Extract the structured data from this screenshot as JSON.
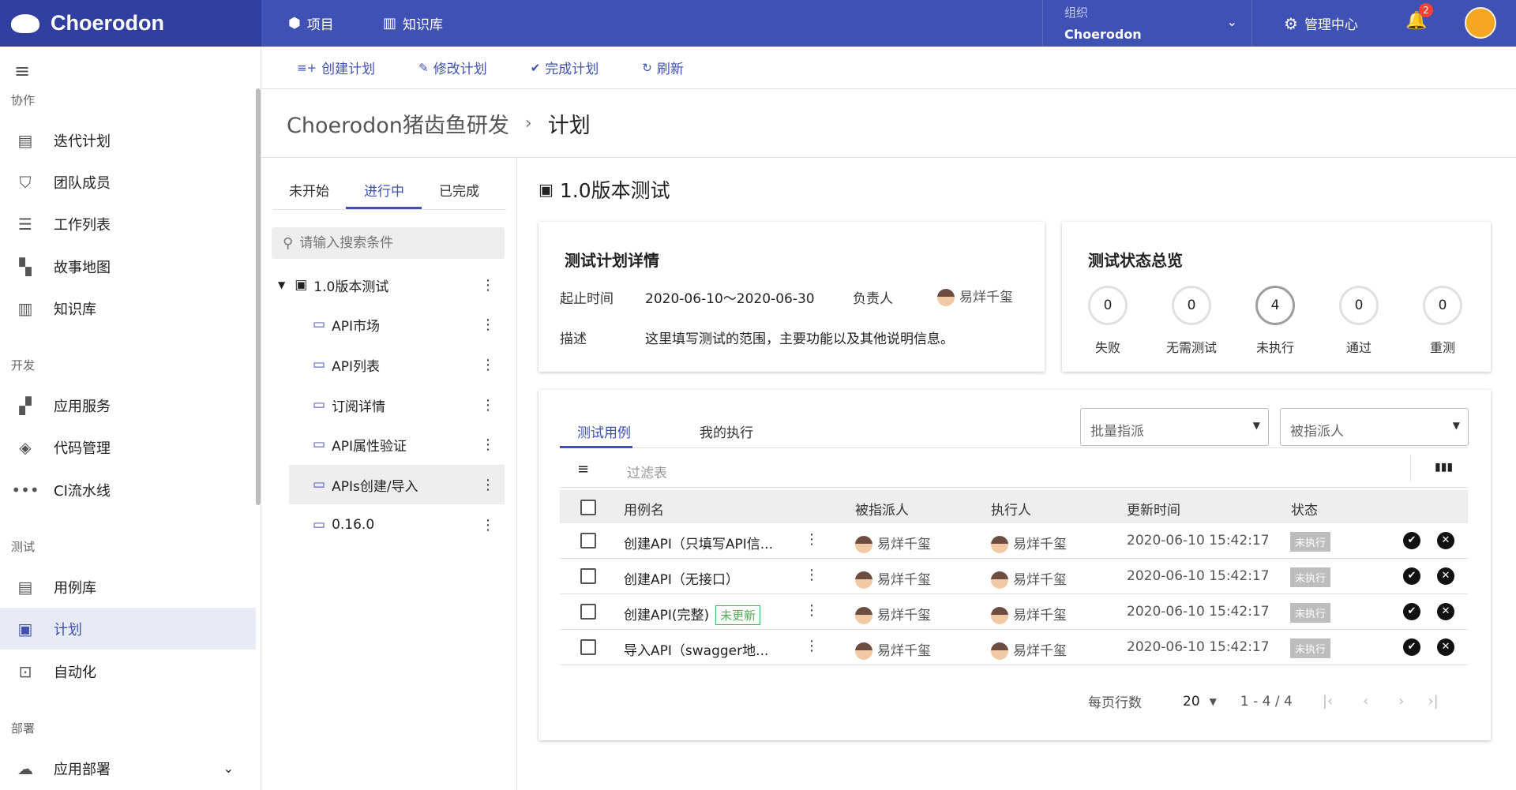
{
  "header": {
    "app_name": "Choerodon",
    "nav": [
      {
        "label": "项目",
        "icon": "cube-icon"
      },
      {
        "label": "知识库",
        "icon": "book-icon"
      }
    ],
    "org_label": "组织",
    "org_value": "Choerodon",
    "mgmt_label": "管理中心",
    "notifications": "2"
  },
  "sidebar": {
    "sections": [
      "协作",
      "开发",
      "测试",
      "部署"
    ],
    "items": [
      {
        "label": "迭代计划",
        "icon": "clipboard-icon"
      },
      {
        "label": "团队成员",
        "icon": "shield-user-icon"
      },
      {
        "label": "工作列表",
        "icon": "list-icon"
      },
      {
        "label": "故事地图",
        "icon": "map-icon"
      },
      {
        "label": "知识库",
        "icon": "book-icon"
      },
      {
        "label": "应用服务",
        "icon": "apps-icon"
      },
      {
        "label": "代码管理",
        "icon": "code-icon"
      },
      {
        "label": "CI流水线",
        "icon": "pipeline-icon"
      },
      {
        "label": "用例库",
        "icon": "document-icon"
      },
      {
        "label": "计划",
        "icon": "calendar-icon"
      },
      {
        "label": "自动化",
        "icon": "automation-icon"
      },
      {
        "label": "应用部署",
        "icon": "cloud-icon"
      }
    ]
  },
  "toolbar": {
    "create_plan": "创建计划",
    "edit_plan": "修改计划",
    "complete_plan": "完成计划",
    "refresh": "刷新"
  },
  "breadcrumb": {
    "project": "Choerodon猪齿鱼研发",
    "current": "计划"
  },
  "plan_panel": {
    "tabs": [
      "未开始",
      "进行中",
      "已完成"
    ],
    "search_placeholder": "请输入搜索条件",
    "root": "1.0版本测试",
    "folders": [
      "API市场",
      "API列表",
      "订阅详情",
      "API属性验证",
      "APIs创建/导入",
      "0.16.0"
    ]
  },
  "main": {
    "title": "1.0版本测试",
    "detail": {
      "title": "测试计划详情",
      "period_label": "起止时间",
      "period_value": "2020-06-10～2020-06-30",
      "owner_label": "负责人",
      "owner_value": "易烊千玺",
      "desc_label": "描述",
      "desc_value": "这里填写测试的范围，主要功能以及其他说明信息。"
    },
    "status": {
      "title": "测试状态总览",
      "items": [
        {
          "label": "失败",
          "count": "0"
        },
        {
          "label": "无需测试",
          "count": "0"
        },
        {
          "label": "未执行",
          "count": "4"
        },
        {
          "label": "通过",
          "count": "0"
        },
        {
          "label": "重测",
          "count": "0"
        }
      ]
    },
    "table": {
      "tabs": [
        "测试用例",
        "我的执行"
      ],
      "batch_assign": "批量指派",
      "assignee": "被指派人",
      "filter_placeholder": "过滤表",
      "columns": [
        "用例名",
        "被指派人",
        "执行人",
        "更新时间",
        "状态"
      ],
      "rows": [
        {
          "name": "创建API（只填写API信...",
          "tag": "",
          "assignee": "易烊千玺",
          "executor": "易烊千玺",
          "updated": "2020-06-10 15:42:17",
          "status": "未执行"
        },
        {
          "name": "创建API（无接口）",
          "tag": "",
          "assignee": "易烊千玺",
          "executor": "易烊千玺",
          "updated": "2020-06-10 15:42:17",
          "status": "未执行"
        },
        {
          "name": "创建API(完整)",
          "tag": "未更新",
          "assignee": "易烊千玺",
          "executor": "易烊千玺",
          "updated": "2020-06-10 15:42:17",
          "status": "未执行"
        },
        {
          "name": "导入API（swagger地...",
          "tag": "",
          "assignee": "易烊千玺",
          "executor": "易烊千玺",
          "updated": "2020-06-10 15:42:17",
          "status": "未执行"
        }
      ],
      "pager": {
        "label": "每页行数",
        "size": "20",
        "range": "1 - 4 / 4"
      }
    }
  }
}
